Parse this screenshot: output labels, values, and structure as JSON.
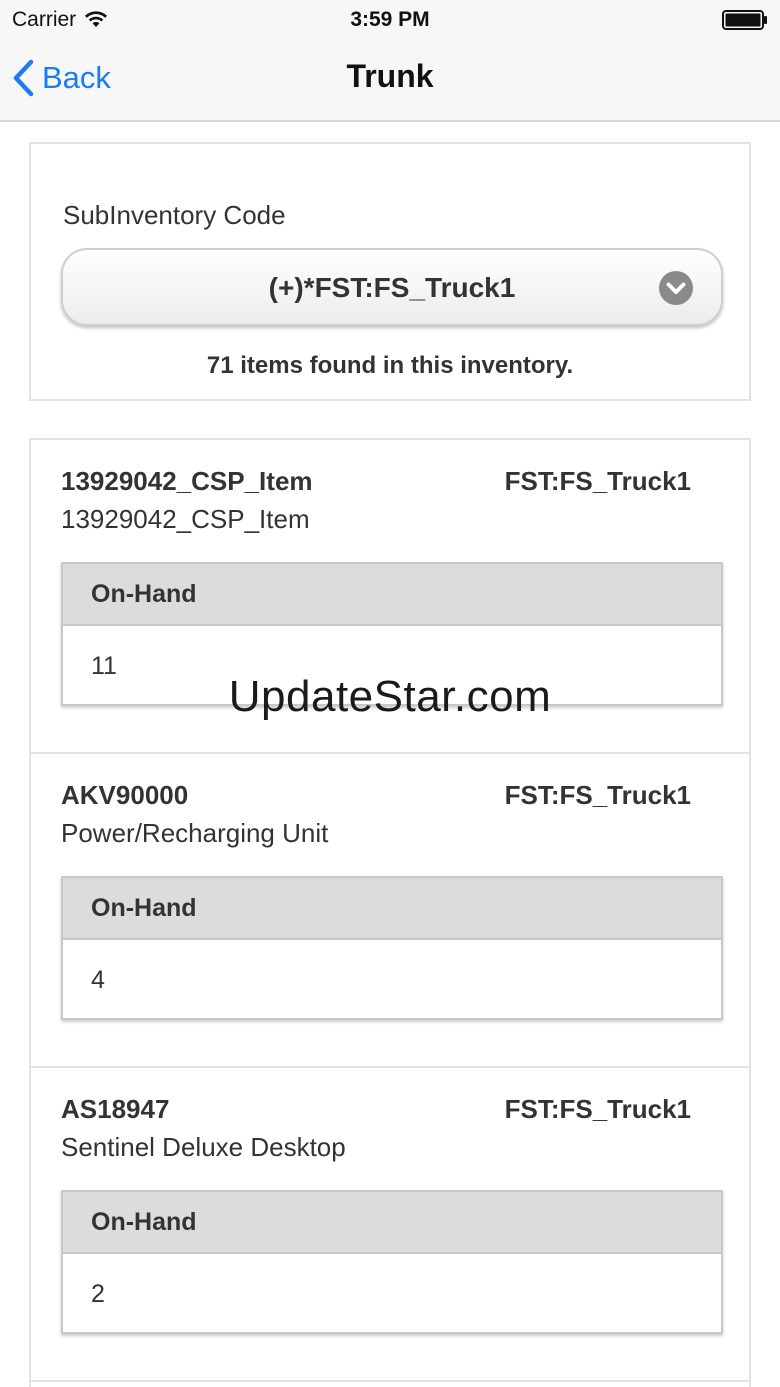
{
  "status_bar": {
    "carrier": "Carrier",
    "time": "3:59 PM"
  },
  "nav": {
    "back_label": "Back",
    "title": "Trunk"
  },
  "subinventory": {
    "label": "SubInventory Code",
    "selected": "(+)*FST:FS_Truck1",
    "items_found": "71 items found in this inventory."
  },
  "items": [
    {
      "code": "13929042_CSP_Item",
      "location": "FST:FS_Truck1",
      "description": "13929042_CSP_Item",
      "onhand_label": "On-Hand",
      "onhand_value": "11"
    },
    {
      "code": "AKV90000",
      "location": "FST:FS_Truck1",
      "description": "Power/Recharging Unit",
      "onhand_label": "On-Hand",
      "onhand_value": "4"
    },
    {
      "code": "AS18947",
      "location": "FST:FS_Truck1",
      "description": "Sentinel Deluxe Desktop",
      "onhand_label": "On-Hand",
      "onhand_value": "2"
    }
  ],
  "watermark": "UpdateStar.com",
  "colors": {
    "accent": "#1a7cf5",
    "table_header": "#dcdcdc"
  }
}
